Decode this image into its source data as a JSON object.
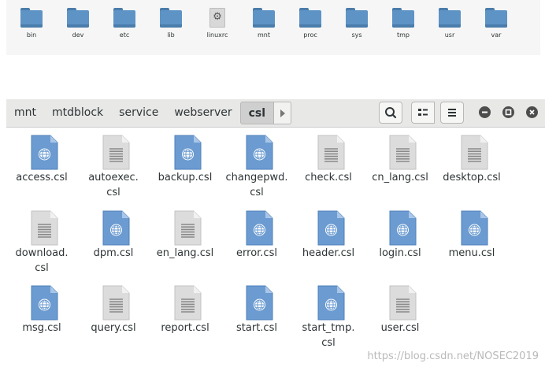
{
  "root_folders": [
    {
      "label": "bin",
      "type": "folder"
    },
    {
      "label": "dev",
      "type": "folder"
    },
    {
      "label": "etc",
      "type": "folder"
    },
    {
      "label": "lib",
      "type": "folder"
    },
    {
      "label": "linuxrc",
      "type": "executable"
    },
    {
      "label": "mnt",
      "type": "folder"
    },
    {
      "label": "proc",
      "type": "folder"
    },
    {
      "label": "sys",
      "type": "folder"
    },
    {
      "label": "tmp",
      "type": "folder"
    },
    {
      "label": "usr",
      "type": "folder"
    },
    {
      "label": "var",
      "type": "folder"
    }
  ],
  "pathbar": {
    "crumbs": [
      "mnt",
      "mtdblock",
      "service",
      "webserver",
      "csl"
    ],
    "active_index": 4
  },
  "icons": {
    "html_file": "globe-document-icon",
    "text_file": "text-document-icon",
    "executable": "gear-icon",
    "folder": "folder-icon"
  },
  "colors": {
    "folder": "#5e93c6",
    "html_doc": "#6b9bd1",
    "text_doc": "#d9d9d9"
  },
  "files": [
    {
      "label": "access.csl",
      "kind": "html"
    },
    {
      "label": "autoexec.\ncsl",
      "kind": "text"
    },
    {
      "label": "backup.csl",
      "kind": "html"
    },
    {
      "label": "changepwd.\ncsl",
      "kind": "html"
    },
    {
      "label": "check.csl",
      "kind": "text"
    },
    {
      "label": "cn_lang.csl",
      "kind": "text"
    },
    {
      "label": "desktop.csl",
      "kind": "text"
    },
    {
      "label": "download.\ncsl",
      "kind": "text"
    },
    {
      "label": "dpm.csl",
      "kind": "html"
    },
    {
      "label": "en_lang.csl",
      "kind": "text"
    },
    {
      "label": "error.csl",
      "kind": "html"
    },
    {
      "label": "header.csl",
      "kind": "html"
    },
    {
      "label": "login.csl",
      "kind": "html"
    },
    {
      "label": "menu.csl",
      "kind": "html"
    },
    {
      "label": "msg.csl",
      "kind": "html"
    },
    {
      "label": "query.csl",
      "kind": "text"
    },
    {
      "label": "report.csl",
      "kind": "text"
    },
    {
      "label": "start.csl",
      "kind": "html"
    },
    {
      "label": "start_tmp.\ncsl",
      "kind": "html"
    },
    {
      "label": "user.csl",
      "kind": "text"
    }
  ],
  "watermark": "https://blog.csdn.net/NOSEC2019"
}
